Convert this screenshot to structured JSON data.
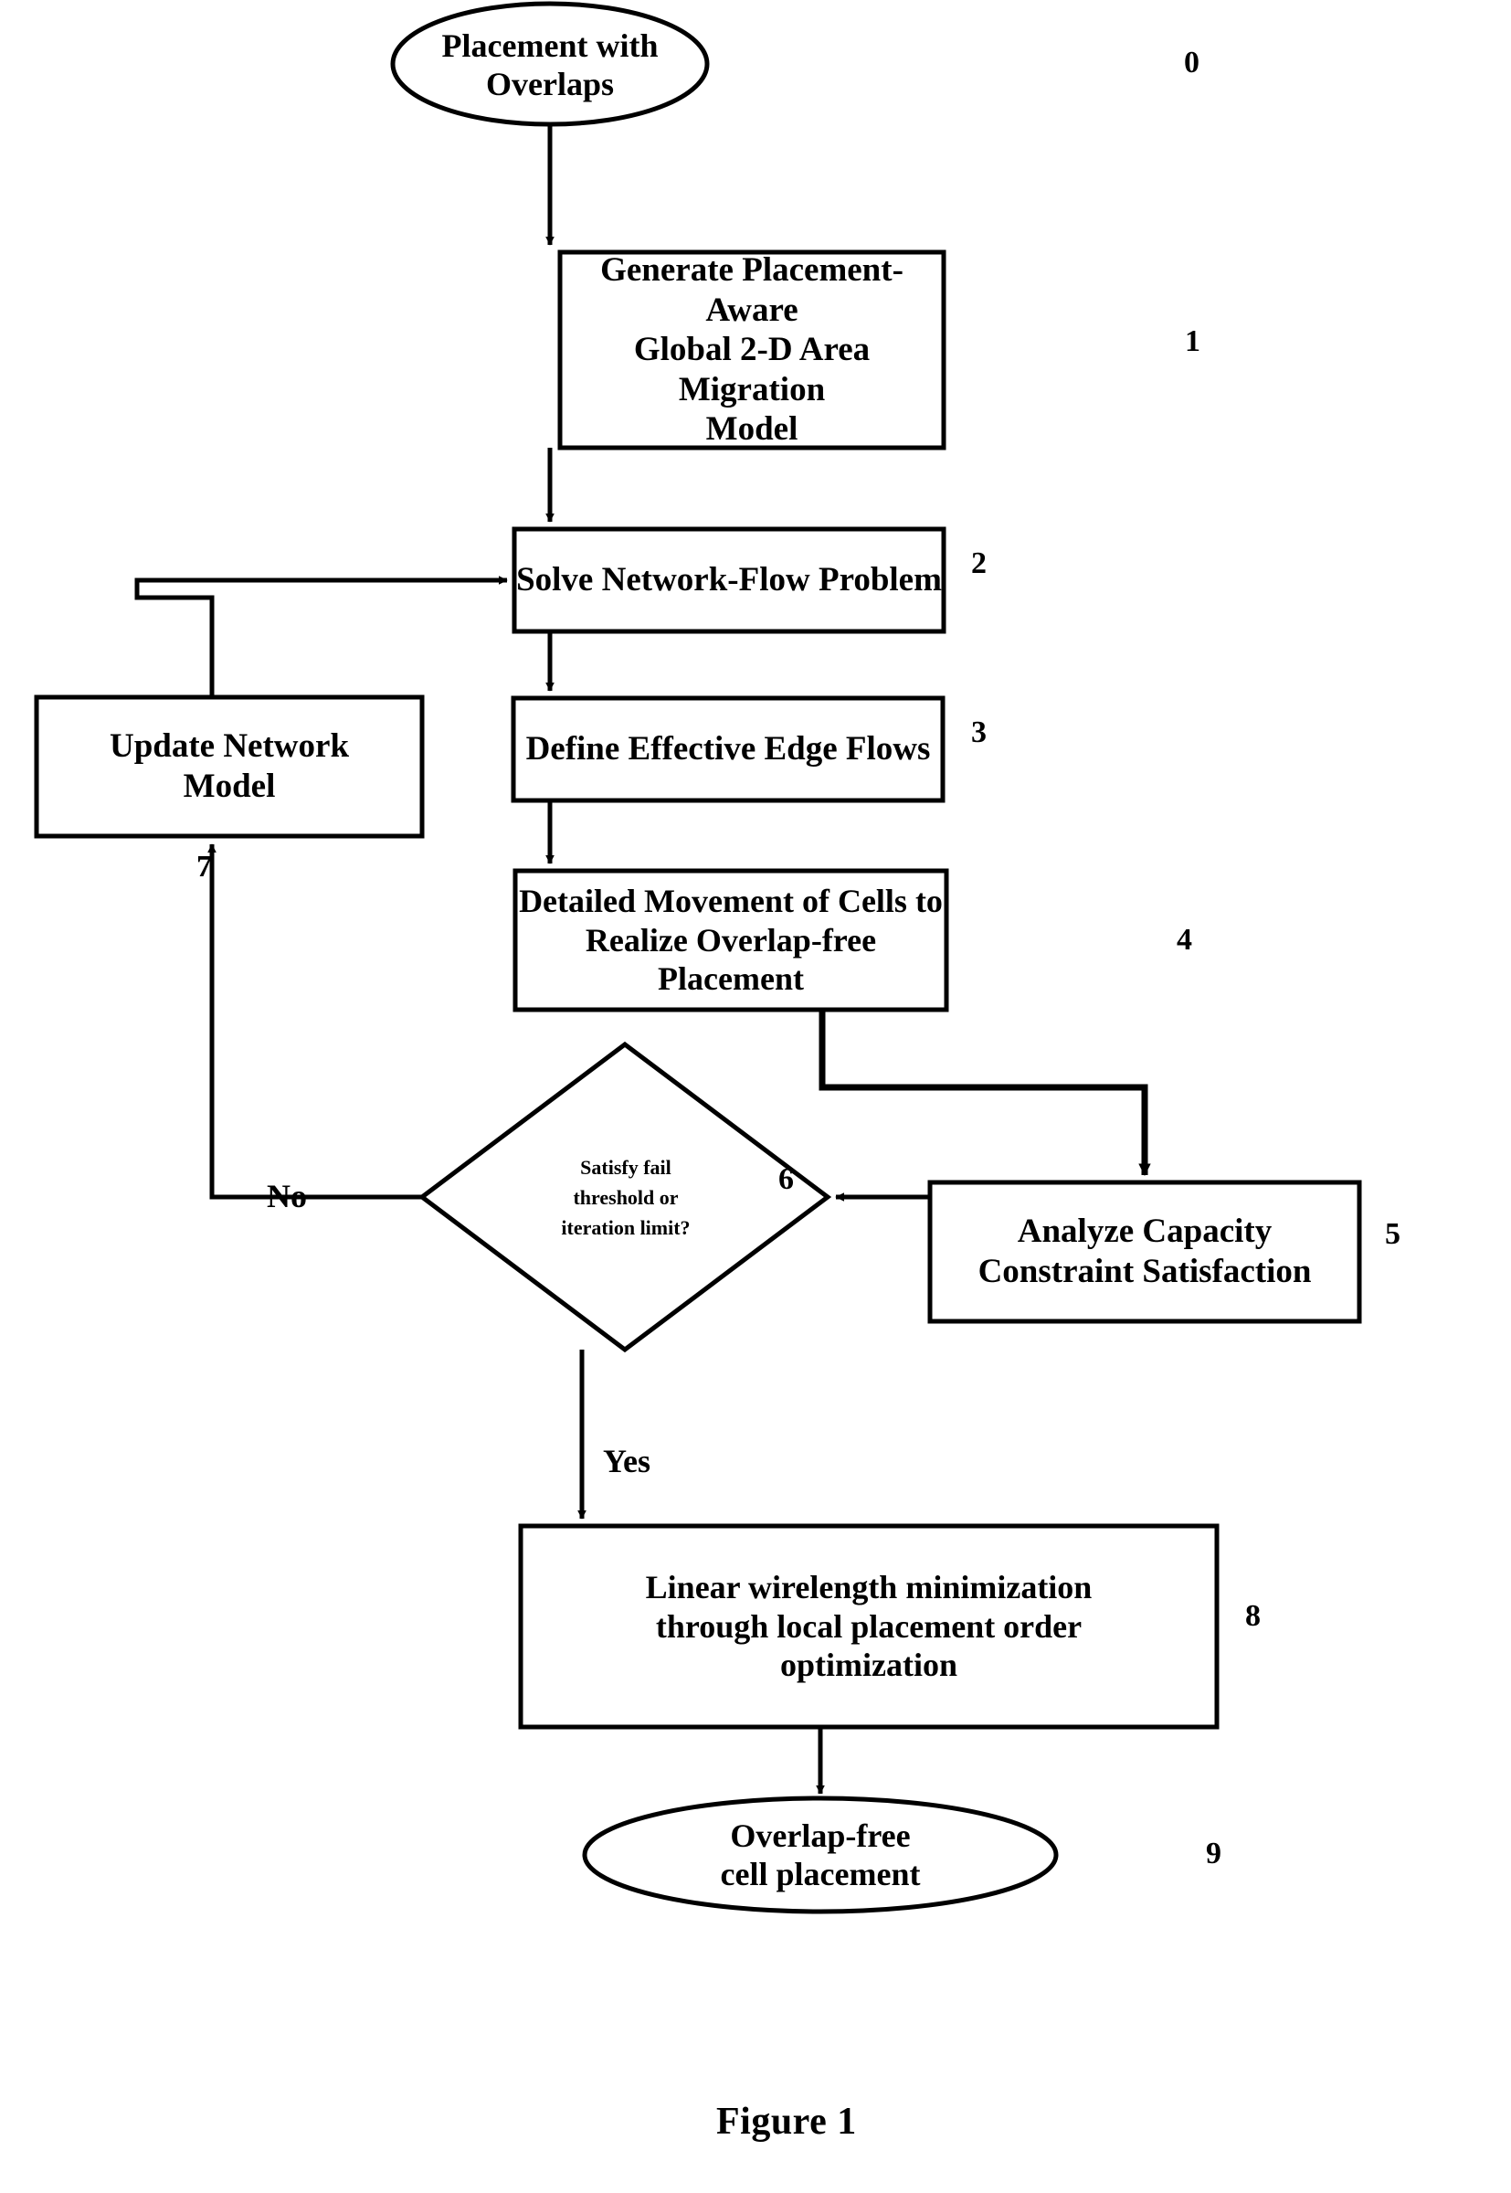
{
  "figure": {
    "caption": "Figure 1"
  },
  "nodes": [
    {
      "id": "start",
      "shape": "ellipse",
      "text": "Placement with\nOverlaps",
      "step": "0"
    },
    {
      "id": "generate-model",
      "shape": "rect",
      "text": "Generate Placement-Aware\nGlobal 2-D Area Migration\nModel",
      "step": "1"
    },
    {
      "id": "solve-network-flow",
      "shape": "rect",
      "text": "Solve Network-Flow Problem",
      "step": "2"
    },
    {
      "id": "define-edge-flows",
      "shape": "rect",
      "text": "Define Effective Edge Flows",
      "step": "3"
    },
    {
      "id": "detailed-movement",
      "shape": "rect",
      "text": "Detailed Movement of Cells to\nRealize Overlap-free Placement",
      "step": "4"
    },
    {
      "id": "analyze-capacity",
      "shape": "rect",
      "text": "Analyze Capacity\nConstraint Satisfaction",
      "step": "5"
    },
    {
      "id": "decision",
      "shape": "diamond",
      "text": "Satisfy fail\nthreshold or\niteration limit?",
      "step": "6"
    },
    {
      "id": "update-network-model",
      "shape": "rect",
      "text": "Update Network\nModel",
      "step": "7"
    },
    {
      "id": "wirelength-minimization",
      "shape": "rect",
      "text": "Linear wirelength minimization\nthrough local placement order\noptimization",
      "step": "8"
    },
    {
      "id": "end",
      "shape": "ellipse",
      "text": "Overlap-free\ncell placement",
      "step": "9"
    }
  ],
  "edge_labels": {
    "no": "No",
    "yes": "Yes"
  },
  "style": {
    "stroke": "#000000",
    "fill": "#ffffff",
    "background": "#ffffff"
  }
}
